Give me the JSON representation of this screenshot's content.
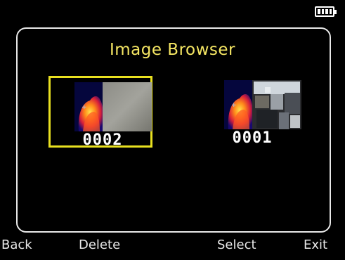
{
  "status": {
    "battery_icon": "battery-full-icon"
  },
  "header": {
    "title": "Image Browser"
  },
  "images": [
    {
      "label": "0002",
      "selected": true
    },
    {
      "label": "0001",
      "selected": false
    }
  ],
  "softkeys": {
    "back": "Back",
    "delete": "Delete",
    "select": "Select",
    "exit": "Exit"
  },
  "colors": {
    "title": "#f5e663",
    "selection": "#e8e020",
    "background": "#000000"
  }
}
